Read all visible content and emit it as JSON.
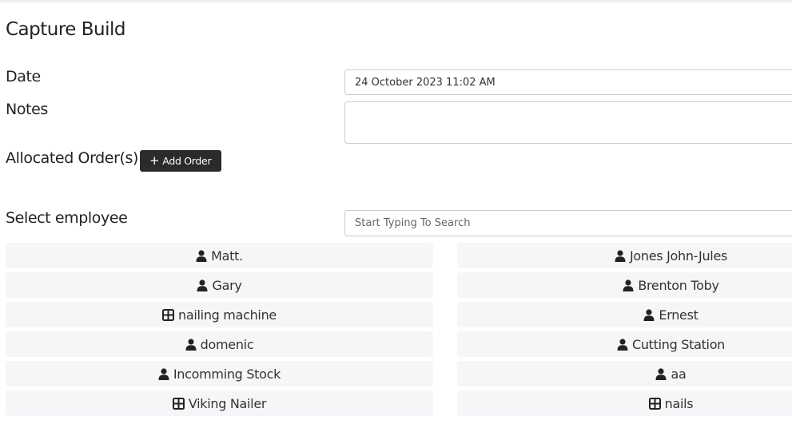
{
  "page": {
    "title": "Capture Build"
  },
  "form": {
    "date_label": "Date",
    "date_value": "24 October 2023 11:02 AM",
    "notes_label": "Notes",
    "notes_value": "",
    "orders_label": "Allocated Order(s)",
    "add_order_label": "Add Order",
    "employee_label": "Select employee",
    "employee_search_placeholder": "Start Typing To Search"
  },
  "employees": [
    {
      "name": "Matt.",
      "icon": "user-icon"
    },
    {
      "name": "Jones John-Jules",
      "icon": "user-icon"
    },
    {
      "name": "Gary",
      "icon": "user-icon"
    },
    {
      "name": "Brenton Toby",
      "icon": "user-icon"
    },
    {
      "name": "nailing machine",
      "icon": "machine-grid-icon"
    },
    {
      "name": "Ernest",
      "icon": "user-icon"
    },
    {
      "name": "domenic",
      "icon": "user-icon"
    },
    {
      "name": "Cutting Station",
      "icon": "user-icon"
    },
    {
      "name": "Incomming Stock",
      "icon": "user-icon"
    },
    {
      "name": "aa",
      "icon": "user-icon"
    },
    {
      "name": "Viking Nailer",
      "icon": "machine-grid-icon"
    },
    {
      "name": "nails",
      "icon": "machine-grid-icon"
    }
  ]
}
